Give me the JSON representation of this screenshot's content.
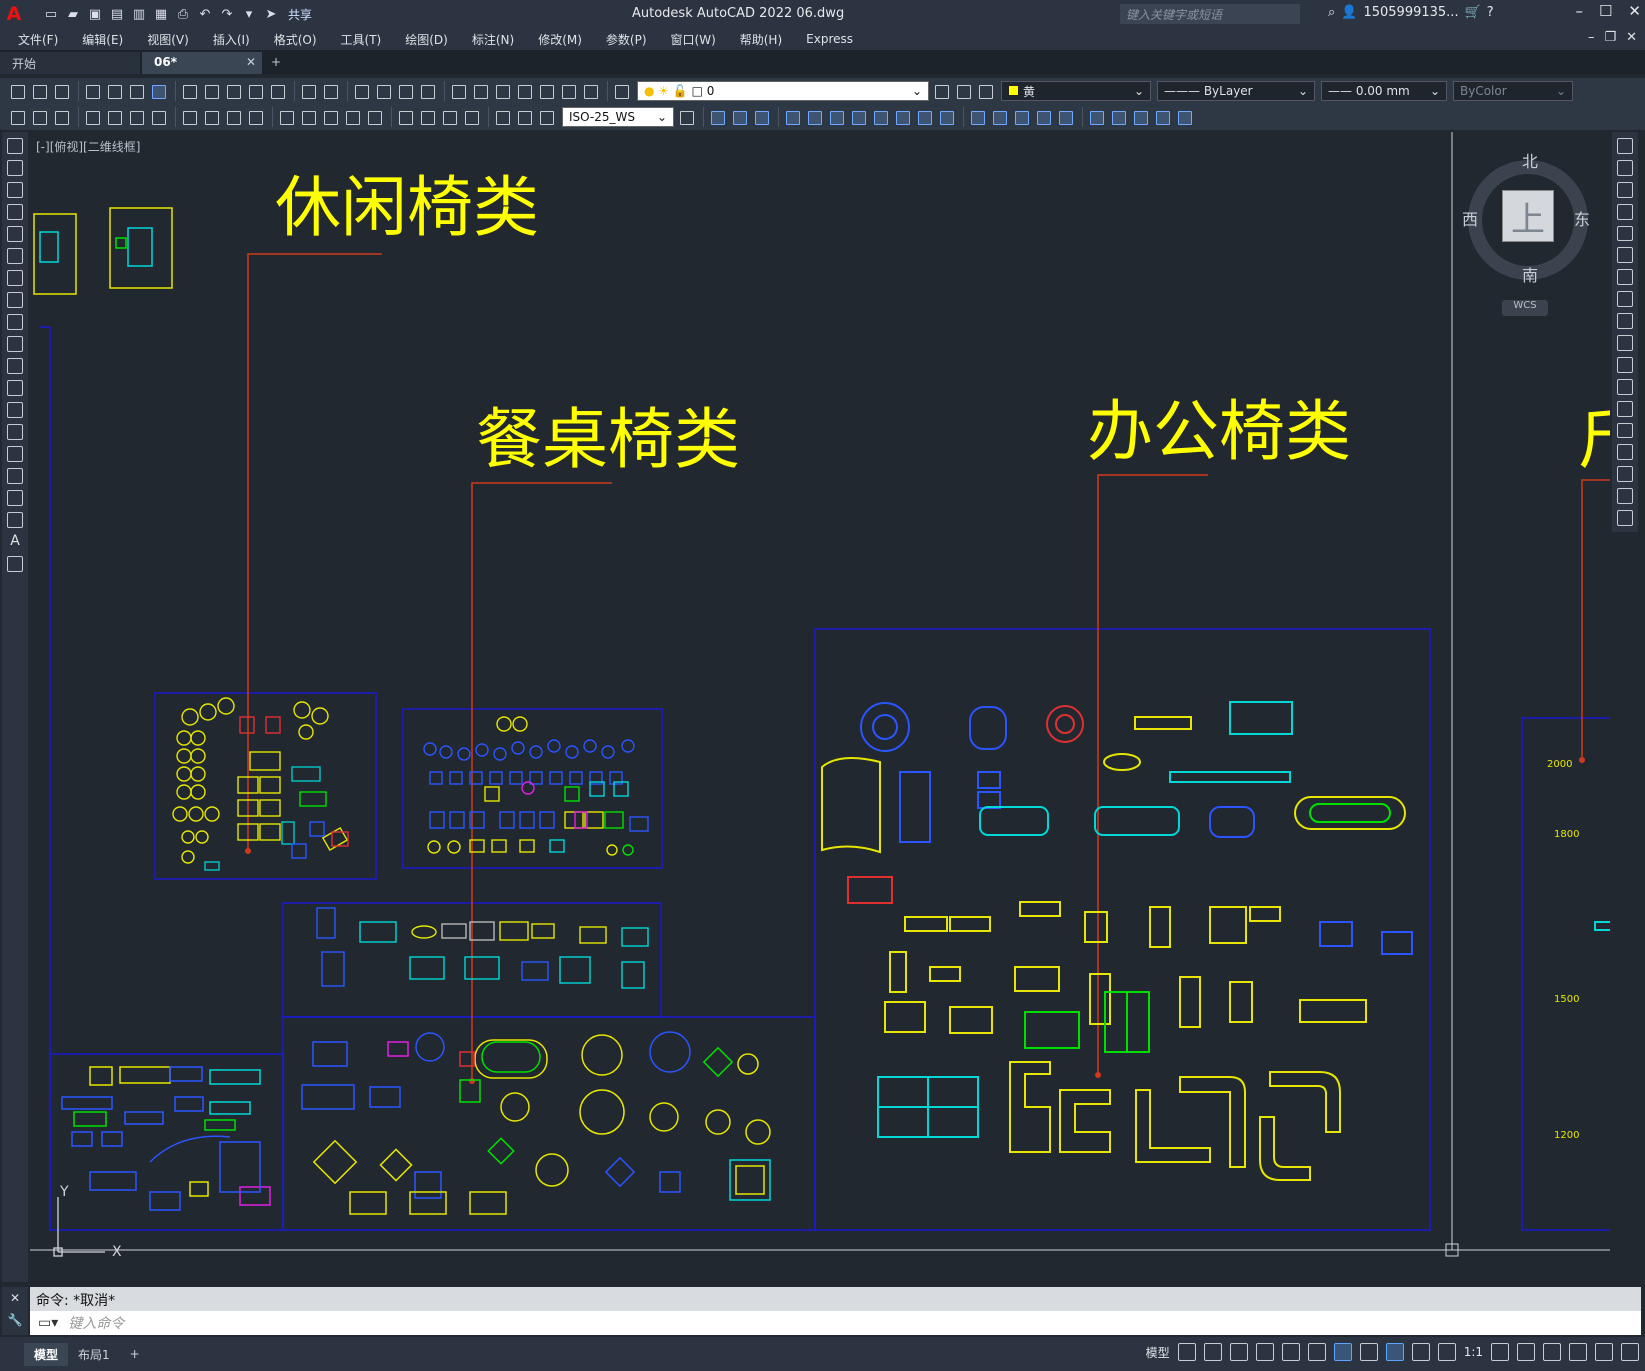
{
  "app": {
    "title": "Autodesk AutoCAD 2022    06.dwg",
    "logo": "A",
    "share_label": "共享",
    "search_placeholder": "键入关键字或短语",
    "user": "1505999135...",
    "window_controls": [
      "–",
      "☐",
      "✕"
    ]
  },
  "menu": [
    "文件(F)",
    "编辑(E)",
    "视图(V)",
    "插入(I)",
    "格式(O)",
    "工具(T)",
    "绘图(D)",
    "标注(N)",
    "修改(M)",
    "参数(P)",
    "窗口(W)",
    "帮助(H)",
    "Express"
  ],
  "tabs": {
    "start": "开始",
    "active": "06*",
    "close": "✕",
    "add": "+"
  },
  "toolbar": {
    "layer_value": "0",
    "color_value": "黄",
    "linetype_value": "ByLayer",
    "lineweight_value": "0.00 mm",
    "plotstyle_value": "ByColor",
    "dimstyle_value": "ISO-25_WS"
  },
  "view": {
    "label": "[-][俯视][二维线框]"
  },
  "viewcube": {
    "north": "北",
    "south": "南",
    "east": "东",
    "west": "西",
    "top": "上",
    "wcs": "WCS"
  },
  "drawing": {
    "headings": [
      "休闲椅类",
      "餐桌椅类",
      "办公椅类"
    ],
    "partial_heading": "斤",
    "dimension_labels": [
      "2000",
      "1800",
      "1500",
      "1200"
    ],
    "ucs_y": "Y",
    "ucs_x": "X"
  },
  "colors": {
    "heading": "#ffff00",
    "leader": "#d03a1a",
    "frame": "#1414c8",
    "canvas_bg": "#212830"
  },
  "command": {
    "history": "命令: *取消*",
    "placeholder": "键入命令"
  },
  "status": {
    "model_tab": "模型",
    "layout_tab": "布局1",
    "add_tab": "+",
    "model_label": "模型",
    "scale": "1:1"
  }
}
